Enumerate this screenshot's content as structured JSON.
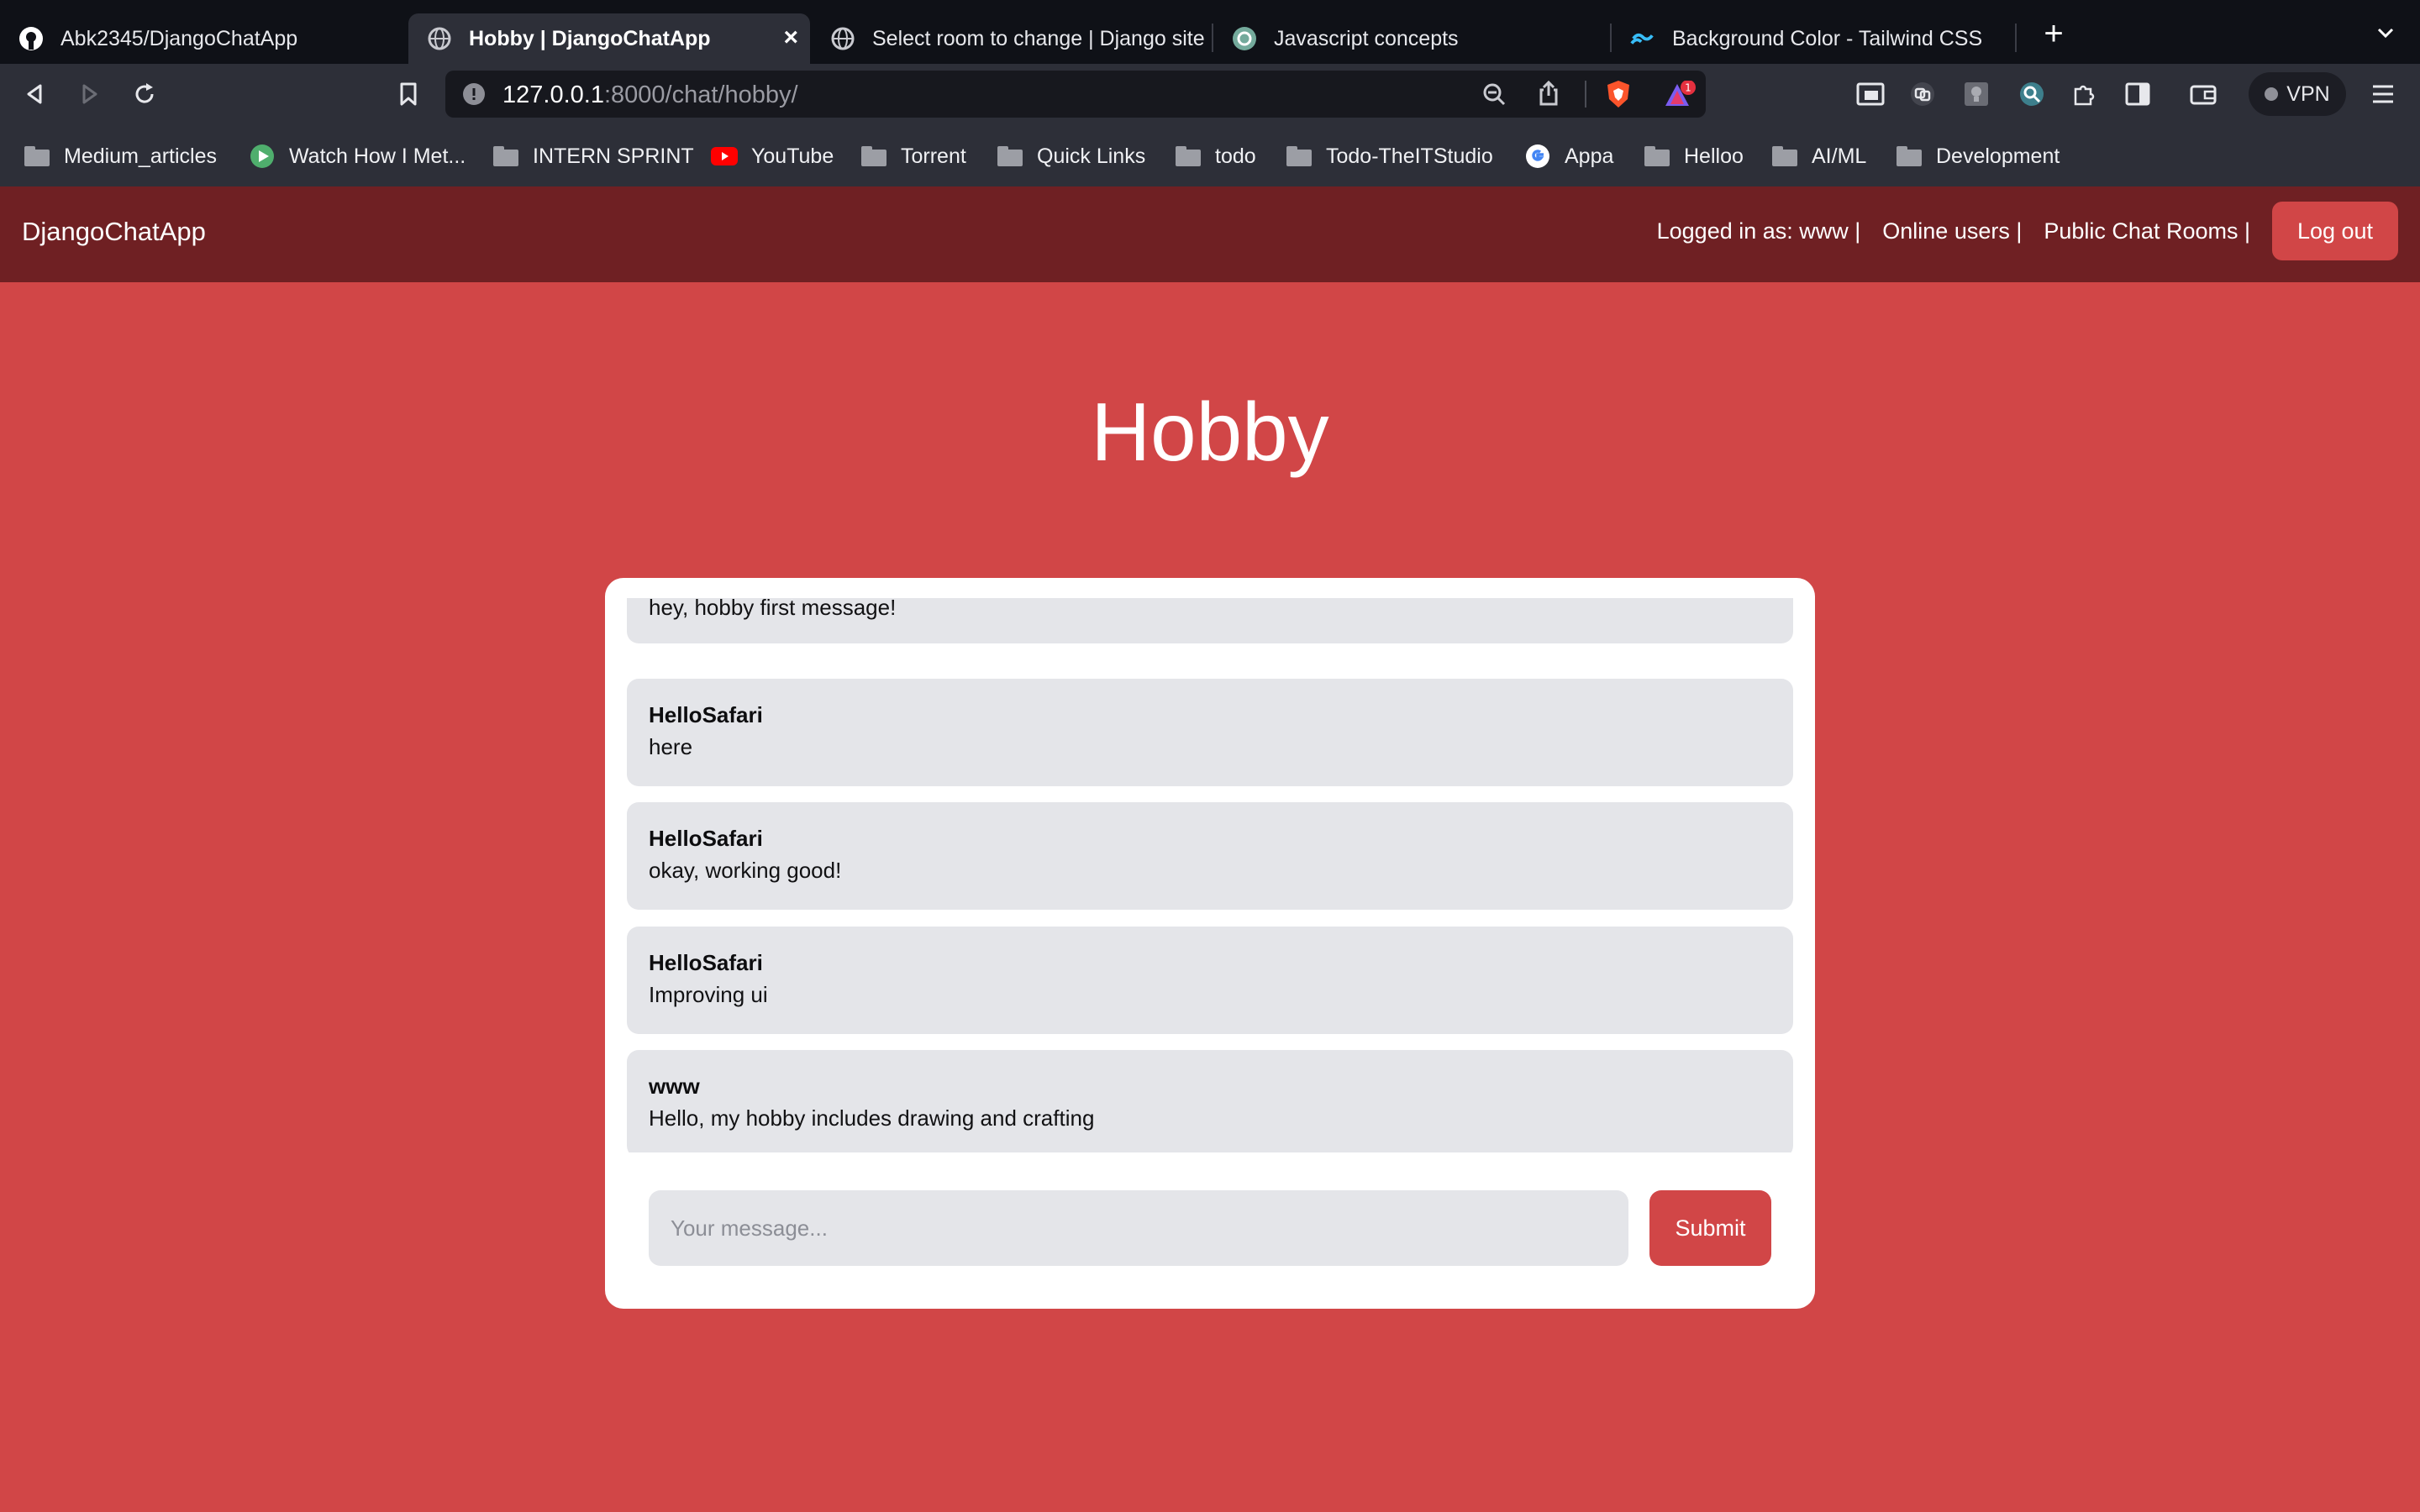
{
  "browser": {
    "tabs": [
      {
        "title": "Abk2345/DjangoChatApp",
        "icon": "github-icon",
        "active": false
      },
      {
        "title": "Hobby | DjangoChatApp",
        "icon": "globe-icon",
        "active": true
      },
      {
        "title": "Select room to change | Django site admin",
        "icon": "globe-icon",
        "active": false
      },
      {
        "title": "Javascript concepts",
        "icon": "chatgpt-icon",
        "active": false
      },
      {
        "title": "Background Color - Tailwind CSS",
        "icon": "tailwind-icon",
        "active": false
      }
    ],
    "url": {
      "host": "127.0.0.1",
      "path": ":8000/chat/hobby/"
    },
    "shield_badge": "1",
    "vpn_label": "VPN",
    "bookmarks": [
      {
        "label": "Medium_articles",
        "icon": "folder-icon"
      },
      {
        "label": "Watch How I Met...",
        "icon": "play-icon"
      },
      {
        "label": "INTERN SPRINT",
        "icon": "folder-icon"
      },
      {
        "label": "YouTube",
        "icon": "youtube-icon"
      },
      {
        "label": "Torrent",
        "icon": "folder-icon"
      },
      {
        "label": "Quick Links",
        "icon": "folder-icon"
      },
      {
        "label": "todo",
        "icon": "folder-icon"
      },
      {
        "label": "Todo-TheITStudio",
        "icon": "folder-icon"
      },
      {
        "label": "Appa",
        "icon": "google-icon"
      },
      {
        "label": "Helloo",
        "icon": "folder-icon"
      },
      {
        "label": "AI/ML",
        "icon": "folder-icon"
      },
      {
        "label": "Development",
        "icon": "folder-icon"
      }
    ]
  },
  "nav": {
    "brand": "DjangoChatApp",
    "logged_in": "Logged in as: www |",
    "online_users": "Online users |",
    "public_rooms": "Public Chat Rooms |",
    "logout_label": "Log out"
  },
  "room": {
    "title": "Hobby"
  },
  "messages": [
    {
      "author": "",
      "body": "hey, hobby first message!"
    },
    {
      "author": "HelloSafari",
      "body": "here"
    },
    {
      "author": "HelloSafari",
      "body": "okay, working good!"
    },
    {
      "author": "HelloSafari",
      "body": "Improving ui"
    },
    {
      "author": "www",
      "body": "Hello, my hobby includes drawing and crafting"
    }
  ],
  "composer": {
    "placeholder": "Your message...",
    "submit_label": "Submit"
  },
  "colors": {
    "page_bg": "#d14647",
    "navbar_bg": "#6f2023",
    "accent": "#d14647",
    "bubble_bg": "#e4e5e9"
  }
}
